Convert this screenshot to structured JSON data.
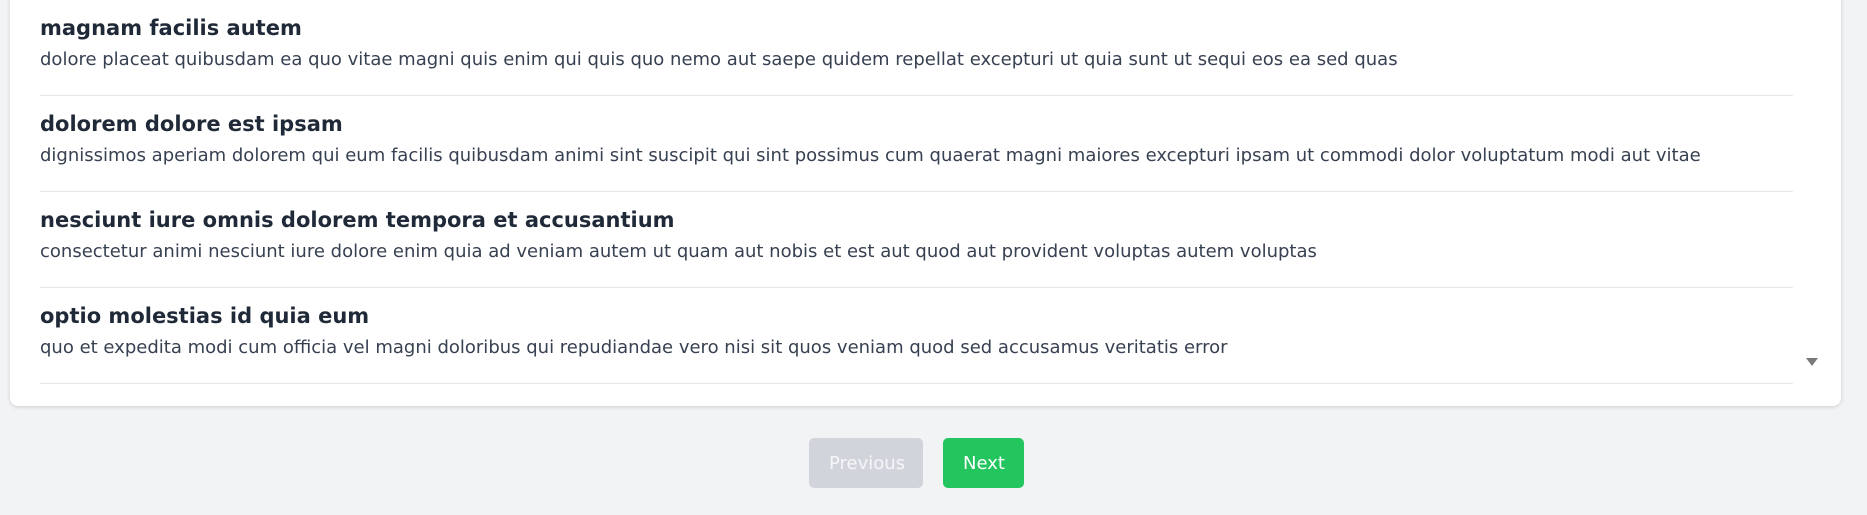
{
  "items": [
    {
      "title": "magnam facilis autem",
      "body": "dolore placeat quibusdam ea quo vitae magni quis enim qui quis quo nemo aut saepe quidem repellat excepturi ut quia sunt ut sequi eos ea sed quas"
    },
    {
      "title": "dolorem dolore est ipsam",
      "body": "dignissimos aperiam dolorem qui eum facilis quibusdam animi sint suscipit qui sint possimus cum quaerat magni maiores excepturi ipsam ut commodi dolor voluptatum modi aut vitae"
    },
    {
      "title": "nesciunt iure omnis dolorem tempora et accusantium",
      "body": "consectetur animi nesciunt iure dolore enim quia ad veniam autem ut quam aut nobis et est aut quod aut provident voluptas autem voluptas"
    },
    {
      "title": "optio molestias id quia eum",
      "body": "quo et expedita modi cum officia vel magni doloribus qui repudiandae vero nisi sit quos veniam quod sed accusamus veritatis error"
    }
  ],
  "pagination": {
    "previous_label": "Previous",
    "next_label": "Next",
    "previous_disabled": true
  },
  "colors": {
    "next_button": "#22c55e",
    "previous_button_disabled": "#d1d5db",
    "page_background": "#f2f3f5"
  }
}
